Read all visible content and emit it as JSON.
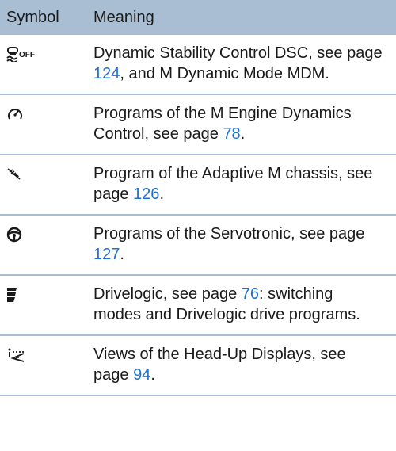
{
  "header": {
    "symbol": "Symbol",
    "meaning": "Meaning"
  },
  "rows": [
    {
      "icon": "dsc-off-icon",
      "pre": "Dynamic Stability Control DSC, see page ",
      "page": "124",
      "post": ", and M Dynamic Mode MDM."
    },
    {
      "icon": "gauge-icon",
      "pre": "Programs of the M Engine Dynam­ics Control, see page ",
      "page": "78",
      "post": "."
    },
    {
      "icon": "shock-absorber-icon",
      "pre": "Program of the Adaptive M chassis, see page ",
      "page": "126",
      "post": "."
    },
    {
      "icon": "steering-wheel-icon",
      "pre": "Programs of the Servotronic, see page ",
      "page": "127",
      "post": "."
    },
    {
      "icon": "drivelogic-icon",
      "pre": "Drivelogic, see page ",
      "page": "76",
      "post": ": switching modes and Drivelogic drive pro­grams."
    },
    {
      "icon": "head-up-display-icon",
      "pre": "Views of the Head-Up Displays, see page ",
      "page": "94",
      "post": "."
    }
  ]
}
